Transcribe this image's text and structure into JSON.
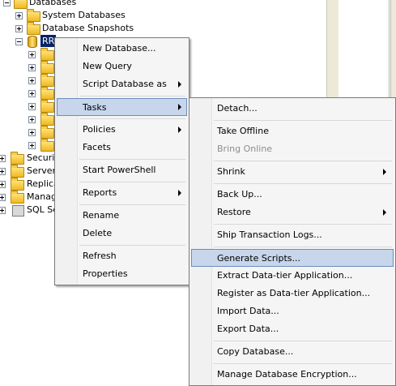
{
  "tree": {
    "databases": "Databases",
    "system_databases": "System Databases",
    "database_snapshots": "Database Snapshots",
    "selected_db": "RR",
    "security": "Securit",
    "server_objects": "Server",
    "replication": "Replica",
    "management": "Manage",
    "sql_agent": "SQL Se"
  },
  "context_menu": {
    "items": [
      {
        "label": "New Database..."
      },
      {
        "label": "New Query"
      },
      {
        "label": "Script Database as"
      },
      {
        "label": "Tasks"
      },
      {
        "label": "Policies"
      },
      {
        "label": "Facets"
      },
      {
        "label": "Start PowerShell"
      },
      {
        "label": "Reports"
      },
      {
        "label": "Rename"
      },
      {
        "label": "Delete"
      },
      {
        "label": "Refresh"
      },
      {
        "label": "Properties"
      }
    ]
  },
  "tasks_menu": {
    "items": [
      {
        "label": "Detach..."
      },
      {
        "label": "Take Offline"
      },
      {
        "label": "Bring Online"
      },
      {
        "label": "Shrink"
      },
      {
        "label": "Back Up..."
      },
      {
        "label": "Restore"
      },
      {
        "label": "Ship Transaction Logs..."
      },
      {
        "label": "Generate Scripts..."
      },
      {
        "label": "Extract Data-tier Application..."
      },
      {
        "label": "Register as Data-tier Application..."
      },
      {
        "label": "Import Data..."
      },
      {
        "label": "Export Data..."
      },
      {
        "label": "Copy Database..."
      },
      {
        "label": "Manage Database Encryption..."
      }
    ]
  },
  "colors": {
    "selection": "#0a246a",
    "menu_highlight": "#c7d6eb",
    "menu_highlight_border": "#6b8dbd",
    "folder": "#f0b81f"
  }
}
